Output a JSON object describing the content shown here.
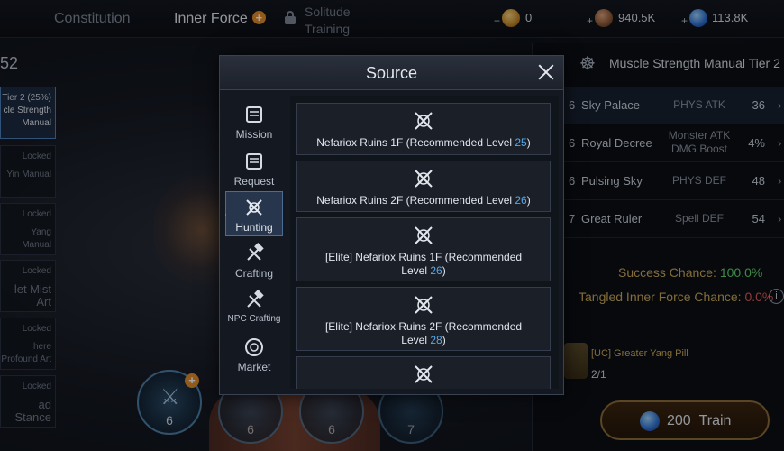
{
  "top_tabs": [
    {
      "label": "Constitution"
    },
    {
      "label": "Inner Force"
    },
    {
      "label": "Solitude\nTraining"
    }
  ],
  "currencies": [
    {
      "icon": "gold-ingot-icon",
      "value": "0",
      "color": "#d9a43a"
    },
    {
      "icon": "copper-coin-icon",
      "value": "940.5K",
      "color": "#9a6a4a"
    },
    {
      "icon": "blue-gem-icon",
      "value": "113.8K",
      "color": "#3a8ee0"
    }
  ],
  "left_panel": {
    "number": "52",
    "manuals": [
      {
        "state": "Tier 2 (25%)",
        "name": "cle Strength Manual",
        "active": true
      },
      {
        "state": "Locked",
        "name": "Yin Manual",
        "active": false
      },
      {
        "state": "Locked",
        "name": "Yang Manual",
        "active": false
      },
      {
        "state": "Locked",
        "name": "let Mist Art",
        "active": false
      },
      {
        "state": "Locked",
        "name": "here Profound Art",
        "active": false
      },
      {
        "state": "Locked",
        "name": "ad Stance",
        "active": false
      }
    ]
  },
  "skills": [
    {
      "level": "6"
    },
    {
      "level": "6"
    },
    {
      "level": "6"
    },
    {
      "level": "7"
    }
  ],
  "right_panel": {
    "title": "Muscle Strength Manual Tier 2",
    "stats": [
      {
        "tier": "6",
        "name": "Sky Palace",
        "type": "PHYS ATK",
        "value": "36"
      },
      {
        "tier": "6",
        "name": "Royal Decree",
        "type": "Monster ATK DMG Boost",
        "value": "4%"
      },
      {
        "tier": "6",
        "name": "Pulsing Sky",
        "type": "PHYS DEF",
        "value": "48"
      },
      {
        "tier": "7",
        "name": "Great Ruler",
        "type": "Spell DEF",
        "value": "54"
      }
    ],
    "success_label": "Success Chance:",
    "success_value": "100.0%",
    "tangled_label": "Tangled Inner Force Chance:",
    "tangled_value": "0.0%",
    "pill_name": "[UC] Greater Yang Pill",
    "pill_count": "2/1",
    "train_cost": "200",
    "train_label": "Train"
  },
  "modal": {
    "title": "Source",
    "categories": [
      {
        "label": "Mission",
        "icon": "scroll-icon"
      },
      {
        "label": "Request",
        "icon": "scroll-icon"
      },
      {
        "label": "Hunting",
        "icon": "crossed-swords-icon",
        "active": true
      },
      {
        "label": "Crafting",
        "icon": "hammer-icon"
      },
      {
        "label": "NPC Crafting",
        "icon": "hammer-icon"
      },
      {
        "label": "Market",
        "icon": "market-icon"
      }
    ],
    "sources": [
      {
        "name": "Nefariox Ruins 1F (Recommended Level ",
        "level": "25",
        "suffix": ")"
      },
      {
        "name": "Nefariox Ruins 2F (Recommended Level ",
        "level": "26",
        "suffix": ")"
      },
      {
        "name": "[Elite] Nefariox Ruins 1F (Recommended Level ",
        "level": "26",
        "suffix": ")"
      },
      {
        "name": "[Elite] Nefariox Ruins 2F (Recommended Level ",
        "level": "28",
        "suffix": ")"
      }
    ]
  }
}
